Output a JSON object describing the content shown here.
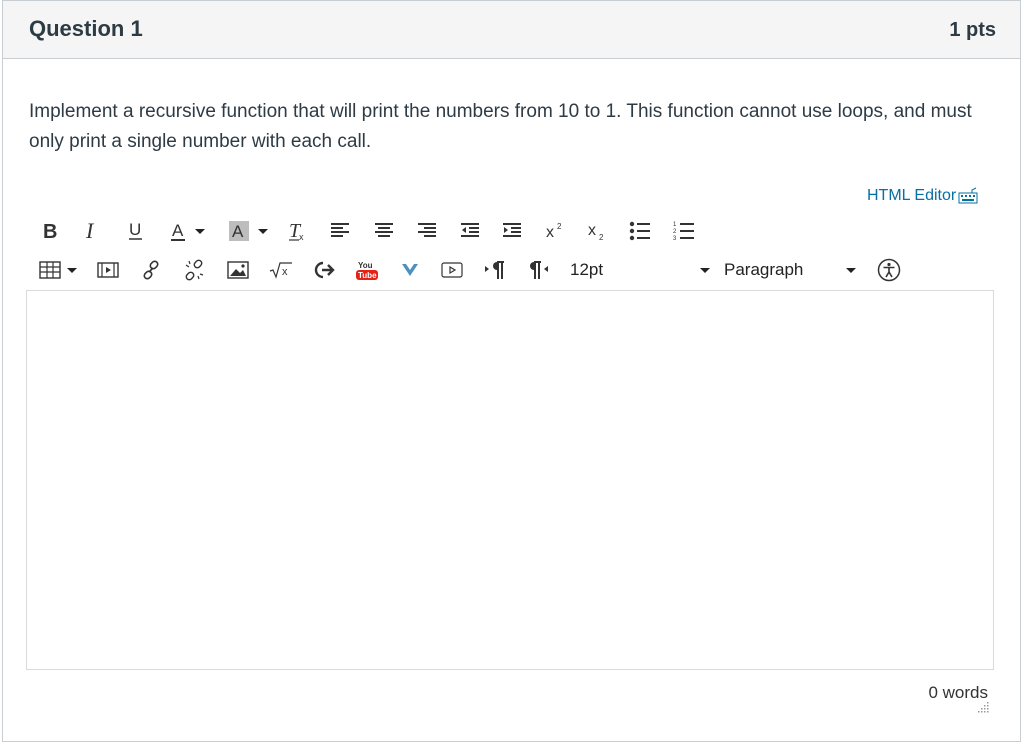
{
  "question": {
    "title": "Question 1",
    "points": "1 pts",
    "text": "Implement a recursive function that will print the numbers from 10 to 1. This function cannot use loops, and must only print a single number with each call."
  },
  "editor": {
    "html_editor_label": "HTML Editor",
    "font_size": "12pt",
    "block_format": "Paragraph",
    "content": "",
    "word_count": "0 words"
  },
  "toolbar": {
    "row1": [
      "bold-icon",
      "italic-icon",
      "underline-icon",
      "text-color-icon",
      "background-color-icon",
      "clear-formatting-icon",
      "align-left-icon",
      "align-center-icon",
      "align-right-icon",
      "outdent-icon",
      "indent-icon",
      "superscript-icon",
      "subscript-icon",
      "bullet-list-icon",
      "numbered-list-icon"
    ],
    "row2": [
      "table-icon",
      "media-icon",
      "link-icon",
      "unlink-icon",
      "image-icon",
      "equation-icon",
      "lti-tool-icon",
      "youtube-icon",
      "vimeo-icon",
      "video-icon",
      "ltr-icon",
      "rtl-icon",
      "font-size-select",
      "block-format-select",
      "accessibility-icon"
    ]
  },
  "colors": {
    "link": "#0770a3",
    "header_bg": "#f5f5f5",
    "border": "#c7cdd1",
    "youtube_red": "#e62117",
    "vimeo_blue": "#4a90c2"
  }
}
